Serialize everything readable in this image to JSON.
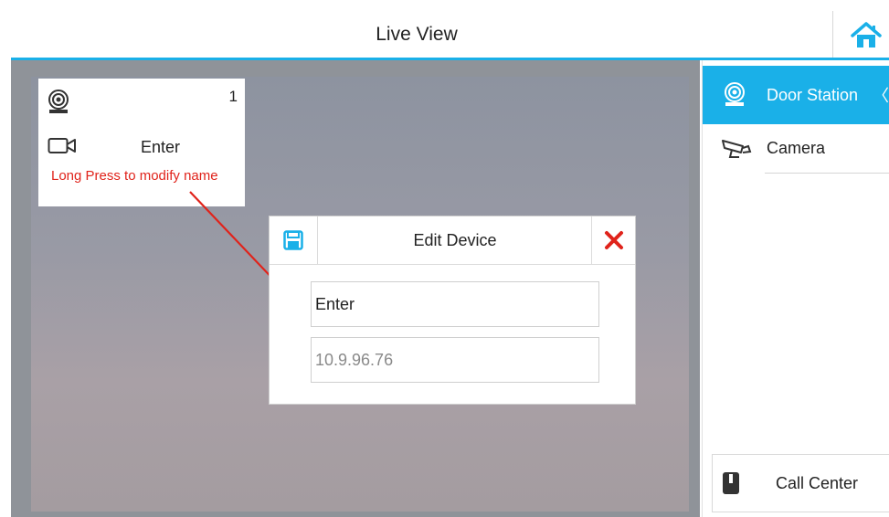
{
  "header": {
    "title": "Live View",
    "home_icon": "home-icon"
  },
  "tile": {
    "index": "1",
    "name": "Enter",
    "hint": "Long Press to modify name",
    "device_icon": "door-station-icon",
    "video_icon": "video-camera-icon"
  },
  "dialog": {
    "title": "Edit Device",
    "save_icon": "save-icon",
    "close_icon": "close-icon",
    "name_value": "Enter",
    "ip_value": "10.9.96.76"
  },
  "sidebar": {
    "items": [
      {
        "label": "Door Station",
        "icon": "door-station-icon",
        "active": true,
        "chevron": "〈"
      },
      {
        "label": "Camera",
        "icon": "camera-icon",
        "active": false
      }
    ],
    "call_center": {
      "label": "Call Center",
      "icon": "call-center-icon"
    }
  },
  "colors": {
    "accent": "#1ab0e8",
    "hint": "#e0231b",
    "close": "#e0231b"
  }
}
